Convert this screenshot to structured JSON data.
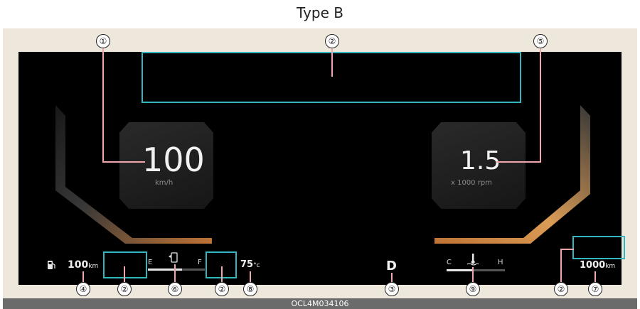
{
  "title": "Type B",
  "footer_code": "OCL4M034106",
  "speedometer": {
    "value": "100",
    "unit": "km/h"
  },
  "tachometer": {
    "value": "1.5",
    "unit": "x 1000 rpm"
  },
  "fuel": {
    "range_value": "100",
    "range_unit": "km",
    "empty_label": "E",
    "full_label": "F"
  },
  "gear": "D",
  "coolant": {
    "temp_value": "75",
    "temp_unit": "°c",
    "cold_label": "C",
    "hot_label": "H"
  },
  "odometer": {
    "value": "1000",
    "unit": "km"
  },
  "callouts": {
    "c1": "①",
    "c2": "②",
    "c3": "③",
    "c4": "④",
    "c5": "⑤",
    "c6": "⑥",
    "c7": "⑦",
    "c8": "⑧",
    "c9": "⑨"
  },
  "colors": {
    "highlight_box": "#31b6c2",
    "leader_line": "#f0a7ab",
    "accent": "#c87a3a"
  }
}
